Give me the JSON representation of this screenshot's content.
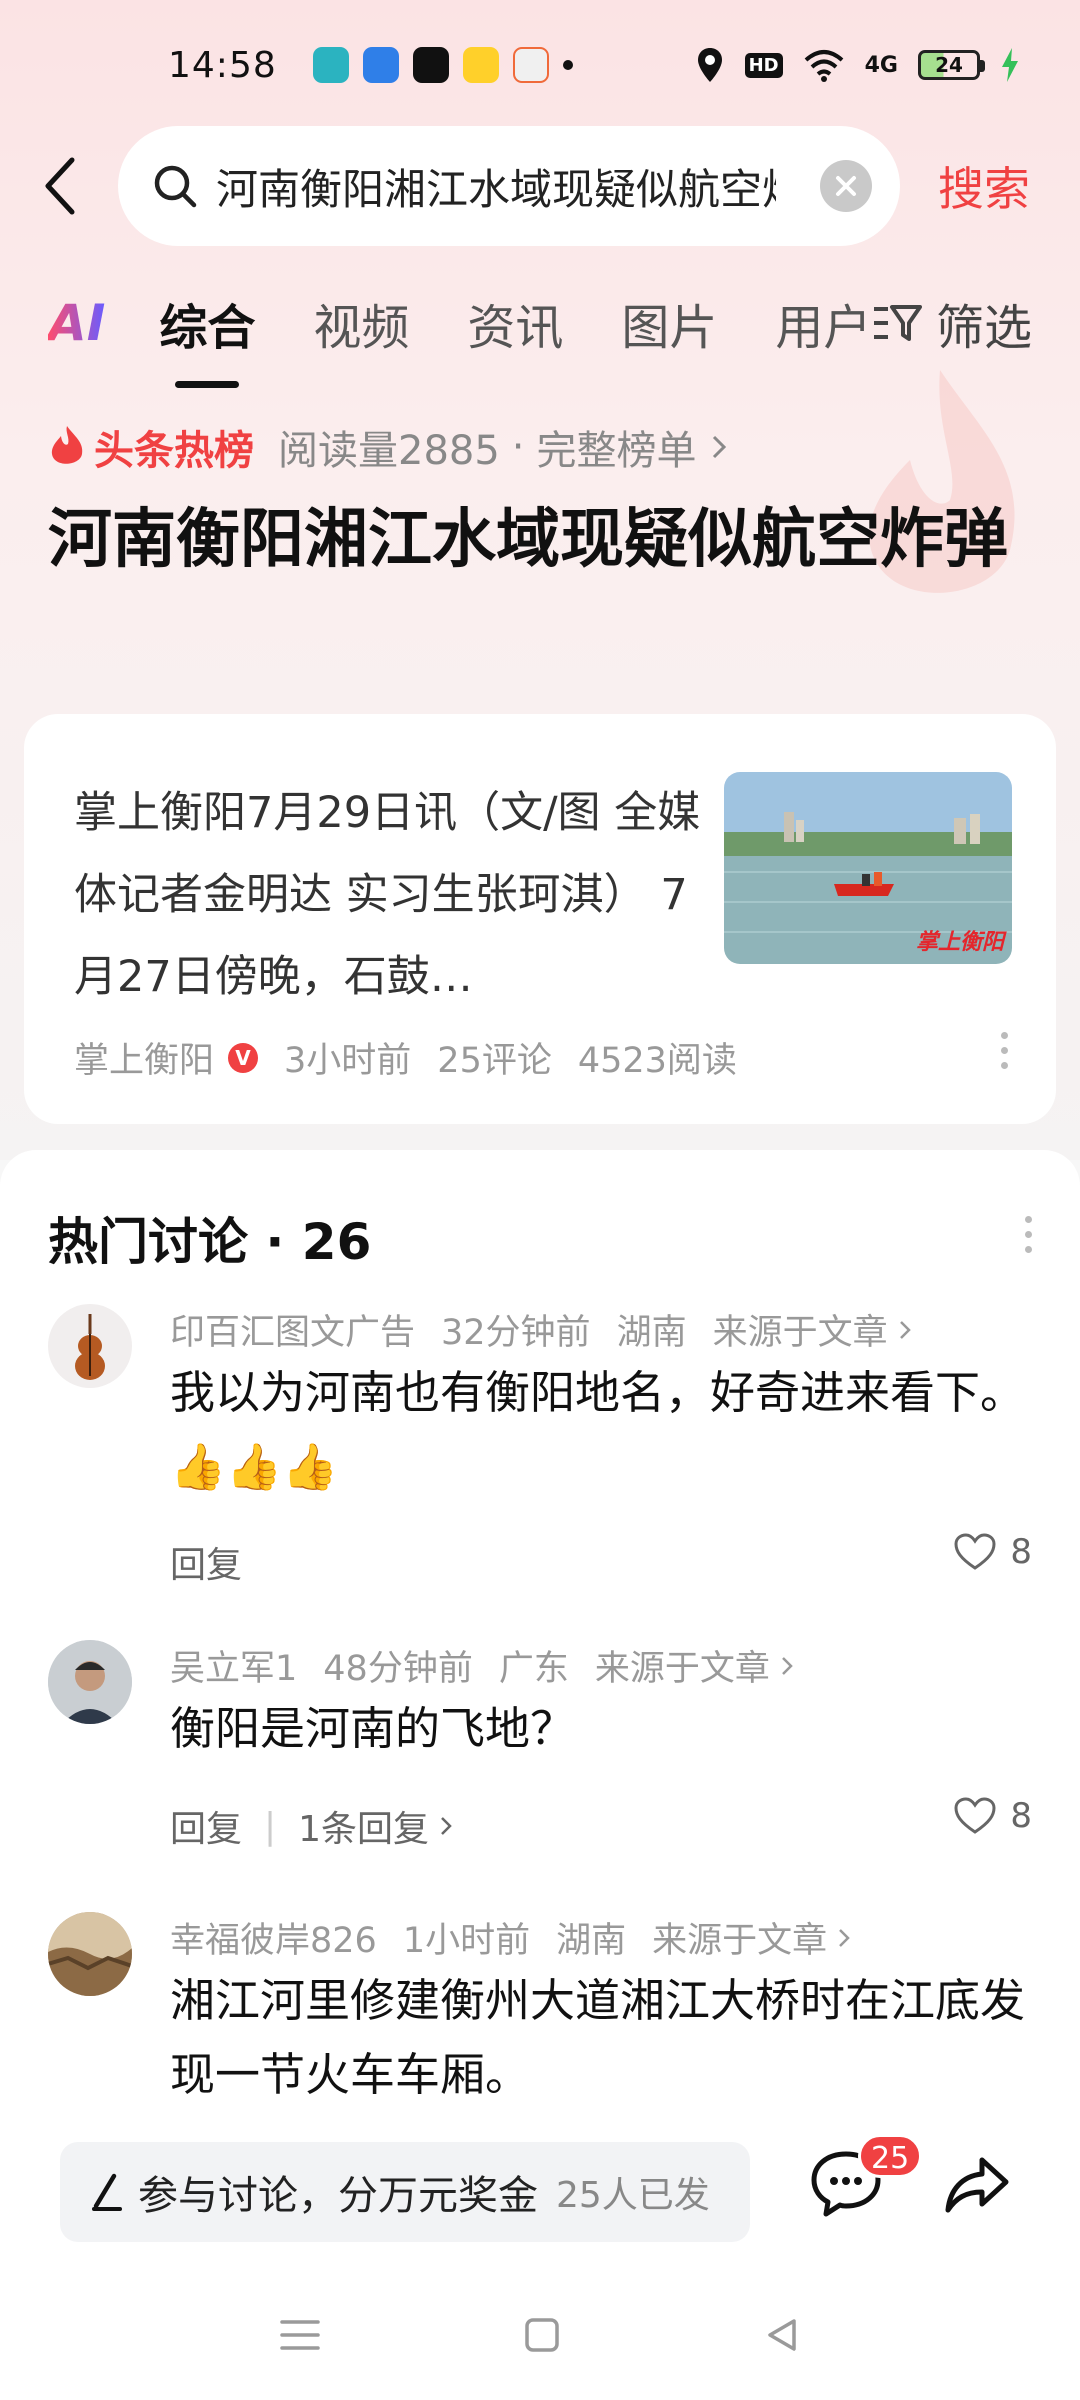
{
  "status_bar": {
    "time": "14:58",
    "network": "4G",
    "hd": "HD",
    "battery": "24"
  },
  "search": {
    "query": "河南衡阳湘江水域现疑似航空炸弹",
    "button_label": "搜索"
  },
  "tabs": {
    "ai_label": "AI",
    "items": [
      "综合",
      "视频",
      "资讯",
      "图片",
      "用户"
    ],
    "active": "综合",
    "filter_label": "筛选"
  },
  "hot_topic": {
    "brand": "头条热榜",
    "read_count": "阅读量2885",
    "separator": "·",
    "full_list": "完整榜单",
    "headline": "河南衡阳湘江水域现疑似航空炸弹"
  },
  "article": {
    "text": "掌上衡阳7月29日讯（文/图 全媒体记者金明达 实习生张珂淇） 7月27日傍晚，石鼓…",
    "source": "掌上衡阳",
    "verified_mark": "V",
    "time": "3小时前",
    "comments": "25评论",
    "reads": "4523阅读",
    "thumb_watermark": "掌上衡阳"
  },
  "discussion": {
    "title": "热门讨论 · 26",
    "comments": [
      {
        "user": "印百汇图文广告",
        "time": "32分钟前",
        "location": "湖南",
        "source": "来源于文章",
        "body": "我以为河南也有衡阳地名，好奇进来看下。👍👍👍",
        "reply_label": "回复",
        "replies": "",
        "likes": "8"
      },
      {
        "user": "吴立军1",
        "time": "48分钟前",
        "location": "广东",
        "source": "来源于文章",
        "body": "衡阳是河南的飞地？",
        "reply_label": "回复",
        "replies": "1条回复",
        "likes": "8"
      },
      {
        "user": "幸福彼岸826",
        "time": "1小时前",
        "location": "湖南",
        "source": "来源于文章",
        "body": "湘江河里修建衡州大道湘江大桥时在江底发现一节火车车厢。",
        "reply_label": "",
        "replies": "",
        "likes": ""
      }
    ]
  },
  "bottom_bar": {
    "join_label": "参与讨论，分万元奖金",
    "join_sub": "25人已发",
    "comment_badge": "25"
  },
  "colors": {
    "accent": "#f04142",
    "text_primary": "#111111",
    "text_secondary": "#999999"
  }
}
